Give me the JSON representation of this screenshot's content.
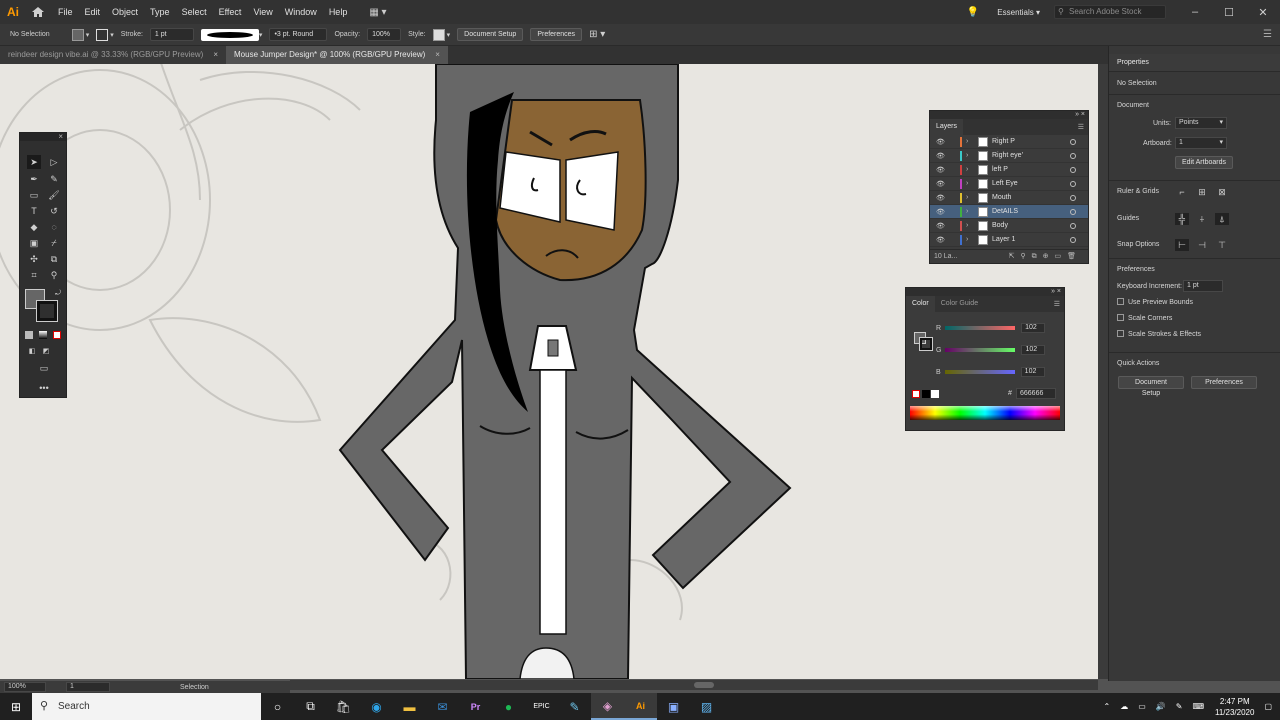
{
  "app": {
    "logo": "Ai",
    "accent": "#ff9a00"
  },
  "menu": [
    "File",
    "Edit",
    "Object",
    "Type",
    "Select",
    "Effect",
    "View",
    "Window",
    "Help"
  ],
  "menubar_right": {
    "workspace": "Essentials",
    "search_placeholder": "Search Adobe Stock"
  },
  "control_bar": {
    "selection": "No Selection",
    "stroke_label": "Stroke:",
    "stroke_value": "1 pt",
    "brush": "3 pt. Round",
    "opacity_label": "Opacity:",
    "opacity_value": "100%",
    "style_label": "Style:",
    "document_setup": "Document Setup",
    "preferences": "Preferences"
  },
  "tabs": [
    {
      "label": "reindeer design vibe.ai @ 33.33% (RGB/GPU Preview)",
      "active": false
    },
    {
      "label": "Mouse Jumper Design* @ 100% (RGB/GPU Preview)",
      "active": true
    }
  ],
  "status": {
    "zoom": "100%",
    "artboard": "1",
    "tool": "Selection"
  },
  "layers": {
    "title": "Layers",
    "rows": [
      {
        "name": "Right P",
        "color": "#e5733a",
        "selected": false
      },
      {
        "name": "Right eye'",
        "color": "#3bc9c9",
        "selected": false
      },
      {
        "name": "left P",
        "color": "#d04040",
        "selected": false
      },
      {
        "name": "Left Eye",
        "color": "#c040c0",
        "selected": false
      },
      {
        "name": "Mouth",
        "color": "#e0c030",
        "selected": false
      },
      {
        "name": "DetAILS",
        "color": "#40b040",
        "selected": true
      },
      {
        "name": "Body",
        "color": "#d05050",
        "selected": false
      },
      {
        "name": "Layer 1",
        "color": "#4070d0",
        "selected": false
      }
    ],
    "footer": "10 La..."
  },
  "color_panel": {
    "tab_color": "Color",
    "tab_guide": "Color Guide",
    "r_label": "R",
    "g_label": "G",
    "b_label": "B",
    "r": "102",
    "g": "102",
    "b": "102",
    "hex_label": "#",
    "hex": "666666"
  },
  "properties": {
    "title": "Properties",
    "selection": "No Selection",
    "document": "Document",
    "units_label": "Units:",
    "units_value": "Points",
    "artboard_label": "Artboard:",
    "artboard_value": "1",
    "edit_artboards": "Edit Artboards",
    "rulers": "Ruler & Grids",
    "guides": "Guides",
    "snap": "Snap Options",
    "preferences": "Preferences",
    "kb_label": "Keyboard Increment:",
    "kb_value": "1 pt",
    "use_preview": "Use Preview Bounds",
    "scale_corners": "Scale Corners",
    "scale_strokes": "Scale Strokes & Effects",
    "quick_actions": "Quick Actions",
    "qa_document_setup": "Document Setup",
    "qa_preferences": "Preferences"
  },
  "taskbar": {
    "search": "Search",
    "time": "2:47 PM",
    "date": "11/23/2020"
  }
}
